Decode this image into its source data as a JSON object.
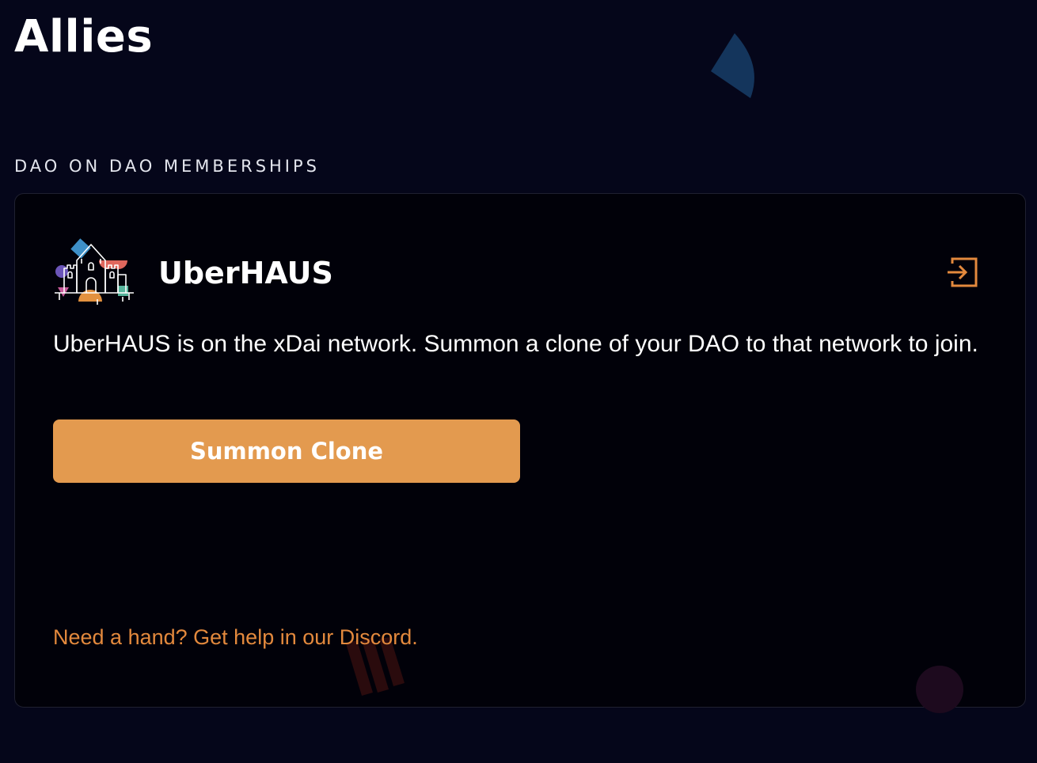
{
  "page": {
    "title": "Allies"
  },
  "section": {
    "label": "DAO ON DAO MEMBERSHIPS"
  },
  "ally": {
    "name": "UberHAUS",
    "logo_icon": "uberhaus-castle-logo",
    "join_icon": "enter-arrow-icon",
    "description": "UberHAUS is on the xDai network. Summon a clone of your DAO to that network to join.",
    "button_label": "Summon Clone",
    "help_text": "Need a hand? Get help in our Discord."
  },
  "colors": {
    "background": "#05061a",
    "card": "#010109",
    "accent": "#e39a4f",
    "link": "#e3893d"
  }
}
